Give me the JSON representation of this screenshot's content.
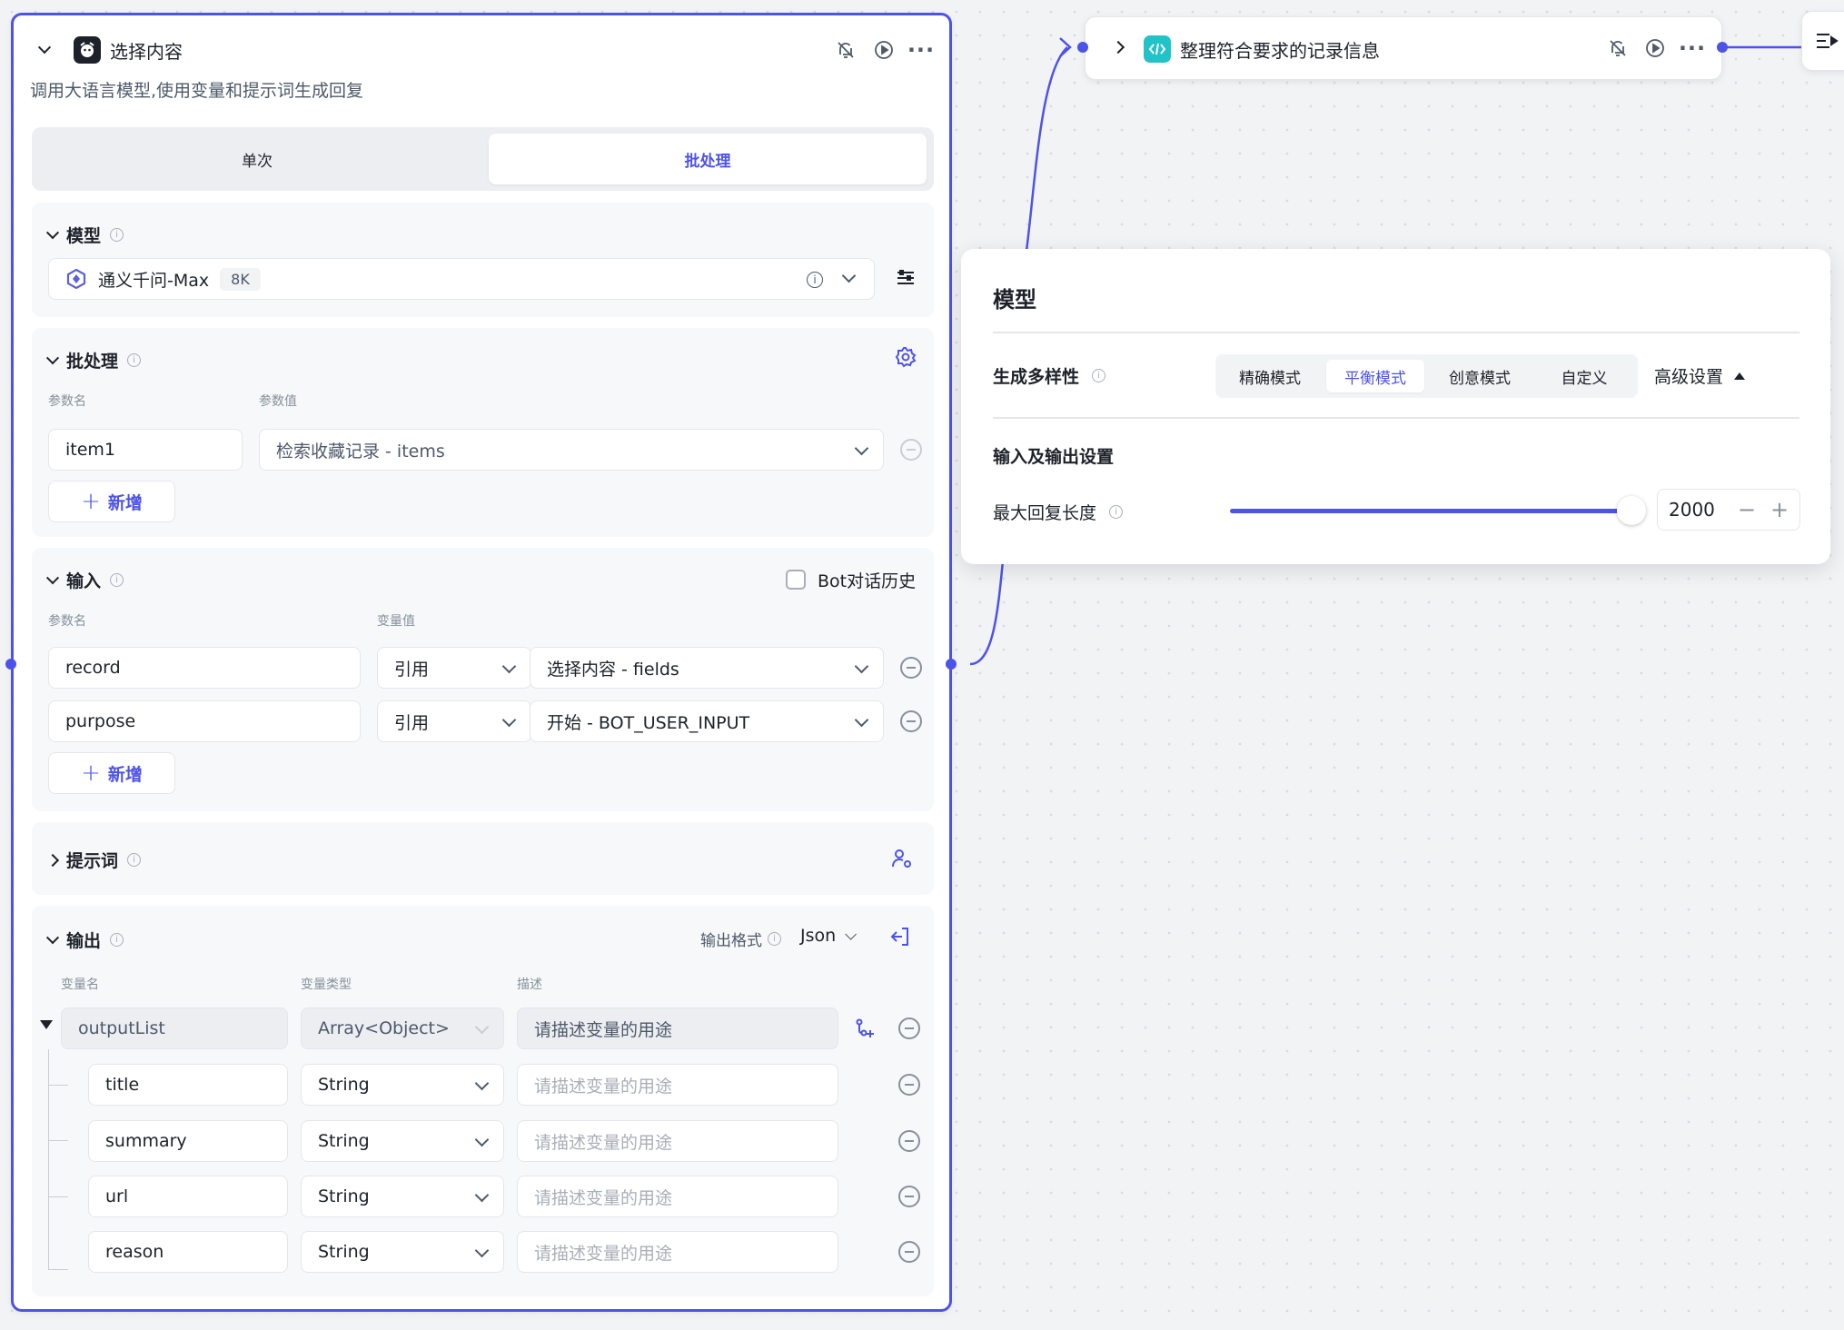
{
  "llm_node": {
    "title": "选择内容",
    "description": "调用大语言模型,使用变量和提示词生成回复",
    "tabs": [
      "单次",
      "批处理"
    ],
    "active_tab": "批处理",
    "model_section": {
      "title": "模型",
      "model_name": "通义千问-Max",
      "model_badge": "8K"
    },
    "batch_section": {
      "title": "批处理",
      "col_param_name": "参数名",
      "col_param_value": "参数值",
      "rows": [
        {
          "name": "item1",
          "value": "检索收藏记录 - items"
        }
      ],
      "add_label": "新增"
    },
    "input_section": {
      "title": "输入",
      "bot_history_label": "Bot对话历史",
      "bot_history_checked": false,
      "col_param_name": "参数名",
      "col_var_value": "变量值",
      "rows": [
        {
          "name": "record",
          "type": "引用",
          "value": "选择内容 - fields"
        },
        {
          "name": "purpose",
          "type": "引用",
          "value": "开始 - BOT_USER_INPUT"
        }
      ],
      "add_label": "新增"
    },
    "prompt_section": {
      "title": "提示词"
    },
    "output_section": {
      "title": "输出",
      "format_label": "输出格式",
      "format_value": "Json",
      "col_var_name": "变量名",
      "col_var_type": "变量类型",
      "col_desc": "描述",
      "root": {
        "name": "outputList",
        "type": "Array<Object>",
        "desc_placeholder": "请描述变量的用途"
      },
      "children": [
        {
          "name": "title",
          "type": "String",
          "desc_placeholder": "请描述变量的用途"
        },
        {
          "name": "summary",
          "type": "String",
          "desc_placeholder": "请描述变量的用途"
        },
        {
          "name": "url",
          "type": "String",
          "desc_placeholder": "请描述变量的用途"
        },
        {
          "name": "reason",
          "type": "String",
          "desc_placeholder": "请描述变量的用途"
        }
      ]
    }
  },
  "code_node": {
    "title": "整理符合要求的记录信息"
  },
  "model_popup": {
    "title": "模型",
    "diversity_label": "生成多样性",
    "modes": [
      "精确模式",
      "平衡模式",
      "创意模式",
      "自定义"
    ],
    "active_mode": "平衡模式",
    "advanced_label": "高级设置",
    "io_title": "输入及输出设置",
    "max_length_label": "最大回复长度",
    "max_length_value": "2000",
    "max_length_fraction": 1.0
  },
  "colors": {
    "accent": "#4d53e8",
    "code_icon": "#22c3c8"
  }
}
